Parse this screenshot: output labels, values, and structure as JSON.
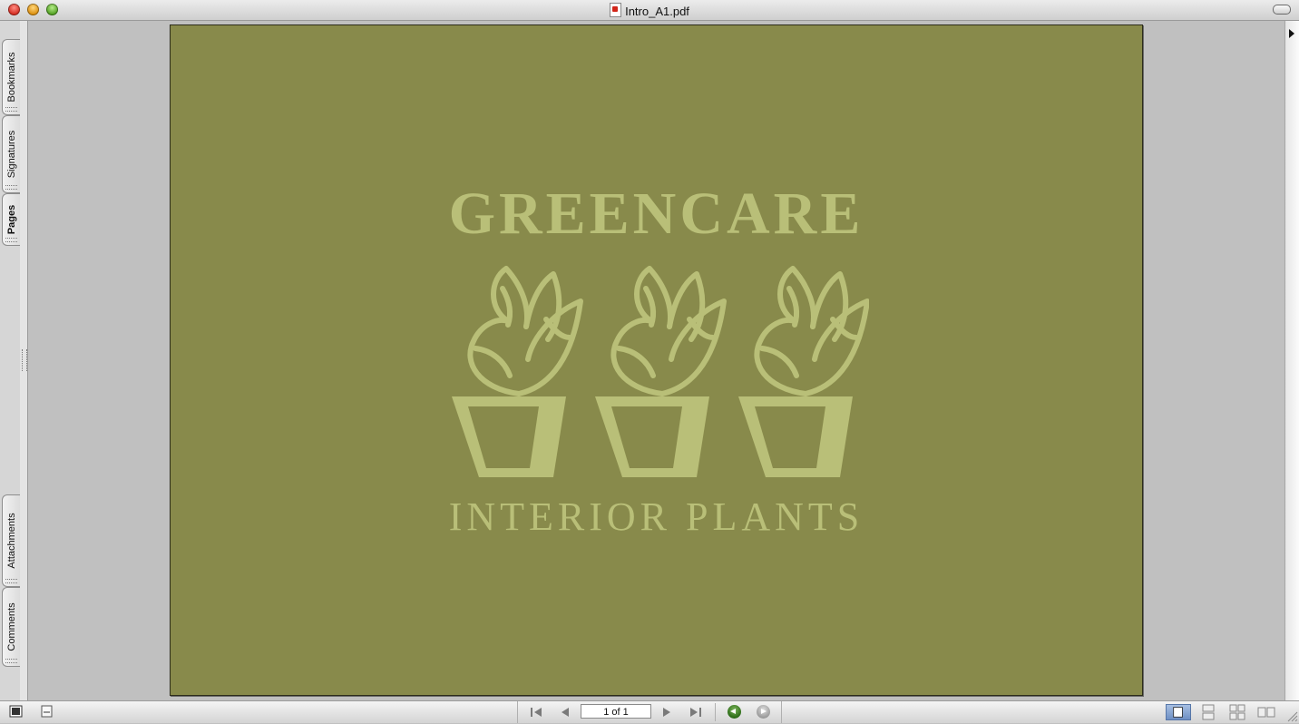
{
  "window": {
    "title": "Intro_A1.pdf"
  },
  "sidebar": {
    "tabs": [
      {
        "label": "Bookmarks",
        "active": false
      },
      {
        "label": "Signatures",
        "active": false
      },
      {
        "label": "Pages",
        "active": true
      },
      {
        "label": "Attachments",
        "active": false
      },
      {
        "label": "Comments",
        "active": false
      }
    ]
  },
  "document": {
    "page_bg_color": "#888a4b",
    "logo_color": "#b9bf78",
    "brand_name": "GREENCARE",
    "tagline": "INTERIOR PLANTS",
    "logo_icon": "three-potted-plants-icon"
  },
  "navigation": {
    "page_indicator": "1 of 1",
    "buttons": [
      "first-page",
      "previous-page",
      "next-page",
      "last-page",
      "go-back",
      "go-forward"
    ]
  },
  "view_modes": {
    "options": [
      "single-page",
      "single-page-continuous",
      "facing",
      "facing-continuous"
    ],
    "selected": "single-page"
  }
}
